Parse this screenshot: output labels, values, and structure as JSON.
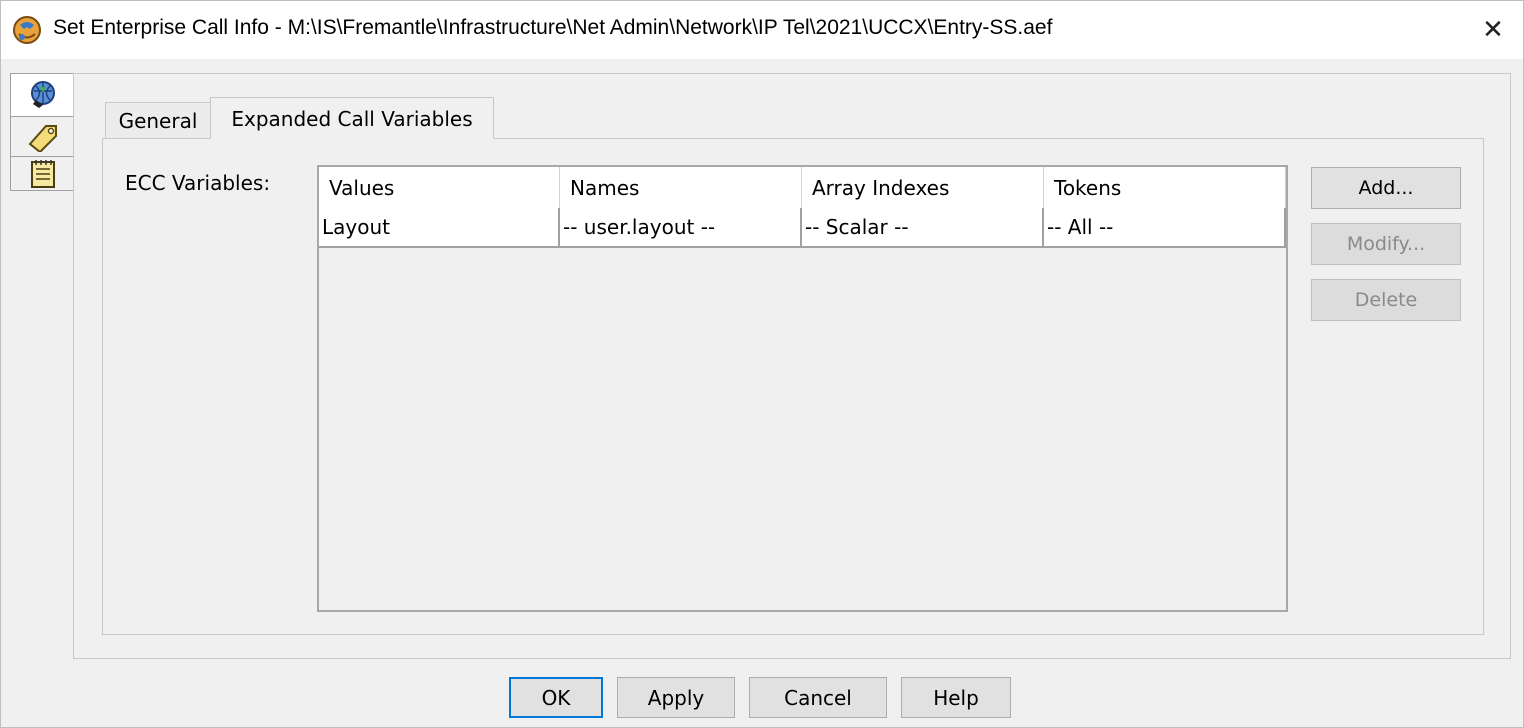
{
  "window": {
    "title": "Set Enterprise Call Info - M:\\IS\\Fremantle\\Infrastructure\\Net Admin\\Network\\IP Tel\\2021\\UCCX\\Entry-SS.aef",
    "close_symbol": "✕"
  },
  "side_tabs": [
    {
      "icon": "globe-phone-icon"
    },
    {
      "icon": "tag-icon"
    },
    {
      "icon": "notepad-icon"
    }
  ],
  "tabs": [
    {
      "label": "General",
      "active": false
    },
    {
      "label": "Expanded Call Variables",
      "active": true
    }
  ],
  "ecc": {
    "label": "ECC Variables:",
    "columns": [
      "Values",
      "Names",
      "Array Indexes",
      "Tokens"
    ],
    "rows": [
      [
        "Layout",
        "-- user.layout --",
        "-- Scalar --",
        "-- All --"
      ]
    ]
  },
  "side_buttons": {
    "add": "Add...",
    "modify": "Modify...",
    "delete": "Delete"
  },
  "dialog_buttons": {
    "ok": "OK",
    "apply": "Apply",
    "cancel": "Cancel",
    "help": "Help"
  },
  "colors": {
    "focus_border": "#0078d7",
    "disabled_text": "#8a8a8a"
  }
}
